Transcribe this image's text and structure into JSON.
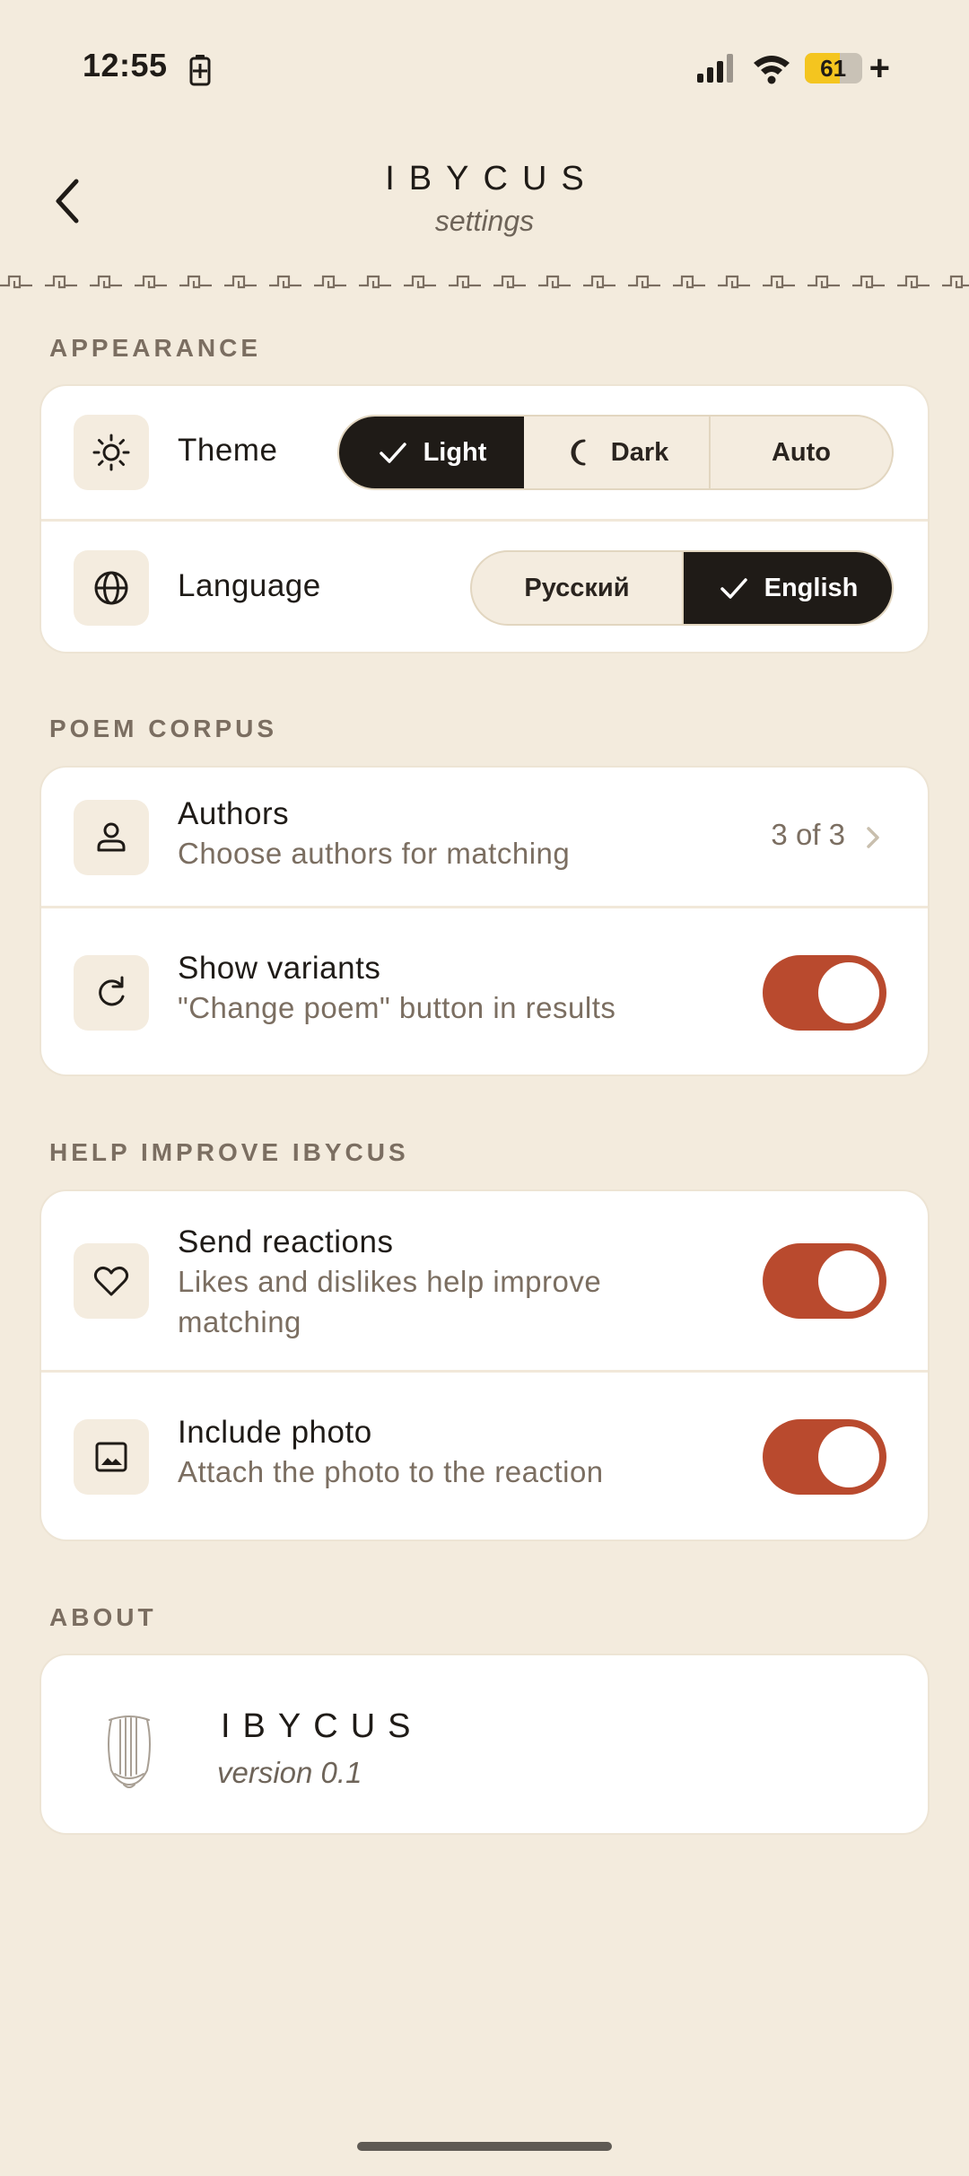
{
  "status": {
    "time": "12:55",
    "battery": "61",
    "battery_fraction": 0.61,
    "charging_plus": "+"
  },
  "header": {
    "title": "IBYCUS",
    "subtitle": "settings"
  },
  "appearance": {
    "label": "APPEARANCE",
    "theme": {
      "label": "Theme",
      "options": [
        "Light",
        "Dark",
        "Auto"
      ],
      "selected": "Light"
    },
    "language": {
      "label": "Language",
      "options": [
        "Русский",
        "English"
      ],
      "selected": "English"
    }
  },
  "corpus": {
    "label": "POEM CORPUS",
    "authors": {
      "title": "Authors",
      "subtitle": "Choose authors for matching",
      "count": "3 of 3"
    },
    "variants": {
      "title": "Show variants",
      "subtitle": "\"Change poem\" button in results",
      "enabled": true
    }
  },
  "improve": {
    "label": "HELP IMPROVE IBYCUS",
    "reactions": {
      "title": "Send reactions",
      "subtitle_line1": "Likes and dislikes help improve",
      "subtitle_line2": "matching",
      "enabled": true
    },
    "photo": {
      "title": "Include photo",
      "subtitle": "Attach the photo to the reaction",
      "enabled": true
    }
  },
  "about": {
    "label": "ABOUT",
    "app_name": "IBYCUS",
    "version": "version 0.1"
  },
  "colors": {
    "background": "#f3ebdd",
    "accent": "#b94a2e",
    "active": "#1f1b17",
    "muted": "#7b6e61"
  }
}
